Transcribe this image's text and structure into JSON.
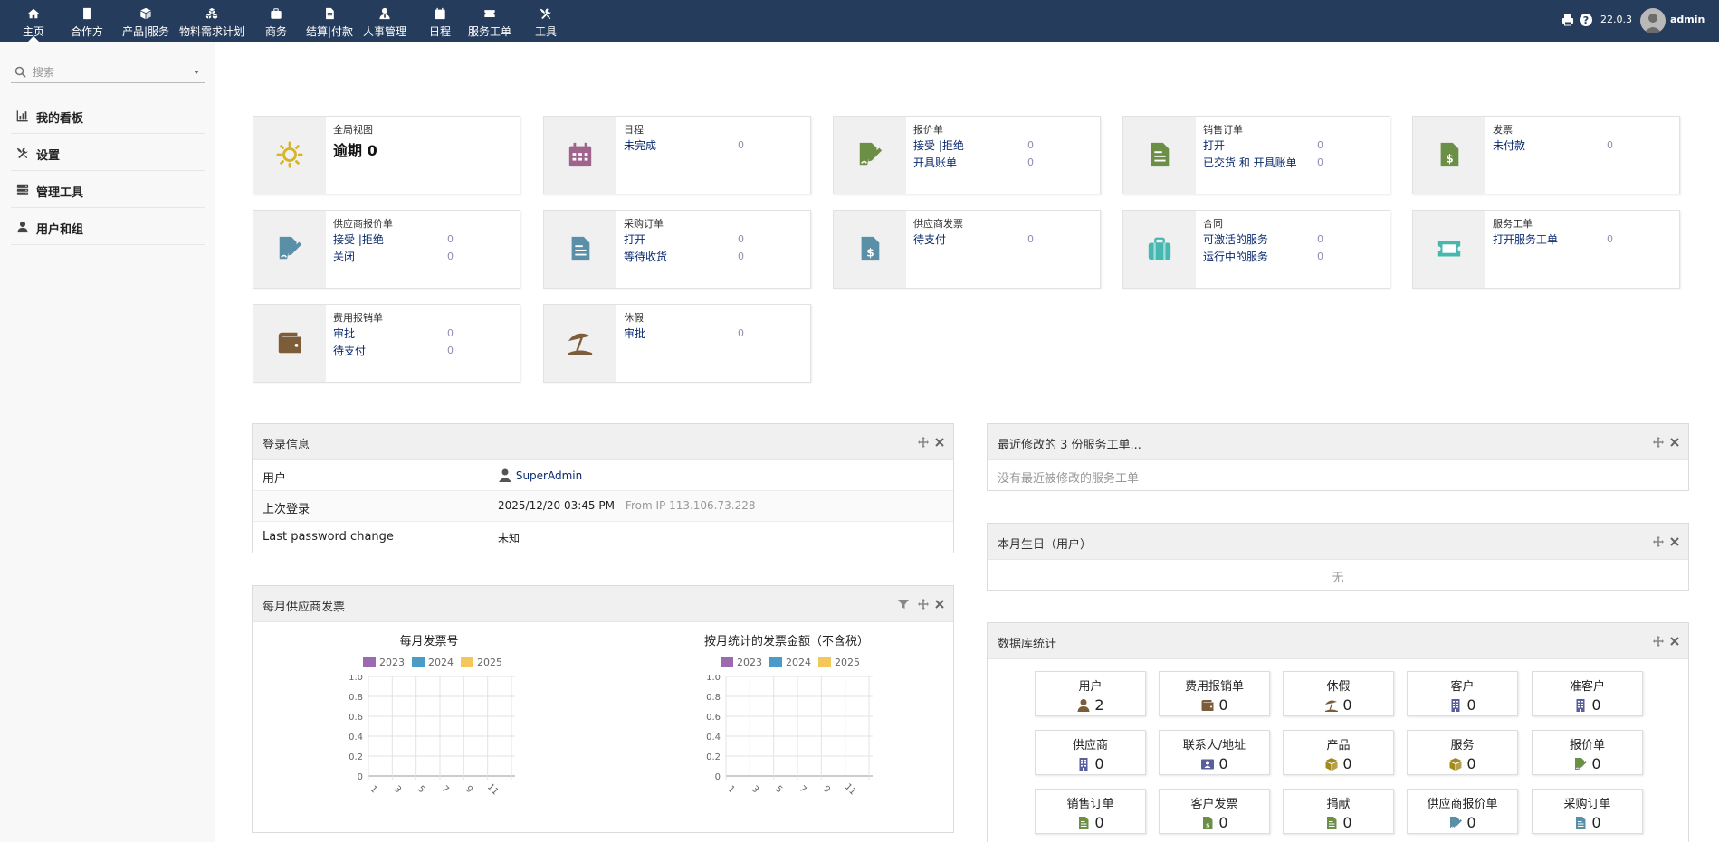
{
  "topbar": {
    "menu": [
      {
        "label": "主页",
        "icon": "home-icon",
        "active": true
      },
      {
        "label": "合作方",
        "icon": "building-icon"
      },
      {
        "label": "产品|服务",
        "icon": "cube-icon"
      },
      {
        "label": "物料需求计划",
        "icon": "cubes-icon"
      },
      {
        "label": "商务",
        "icon": "suitcase-icon"
      },
      {
        "label": "结算|付款",
        "icon": "file-invoice-icon"
      },
      {
        "label": "人事管理",
        "icon": "user-tie-icon"
      },
      {
        "label": "日程",
        "icon": "calendar-icon"
      },
      {
        "label": "服务工单",
        "icon": "ticket-icon"
      },
      {
        "label": "工具",
        "icon": "tools-icon"
      }
    ],
    "version": "22.0.3",
    "user": "admin"
  },
  "sidebar": {
    "search_placeholder": "搜索",
    "items": [
      {
        "label": "我的看板",
        "icon": "chart-icon"
      },
      {
        "label": "设置",
        "icon": "tools-icon"
      },
      {
        "label": "管理工具",
        "icon": "server-icon"
      },
      {
        "label": "用户和组",
        "icon": "user-icon"
      }
    ]
  },
  "boxes": [
    {
      "title": "全局视图",
      "big": "逾期 0",
      "icon": "sun-icon",
      "icon_color": "#d6b52a"
    },
    {
      "title": "日程",
      "icon": "calendar-icon",
      "icon_color": "#a0648c",
      "rows": [
        {
          "label": "未完成",
          "count": "0"
        }
      ]
    },
    {
      "title": "报价单",
      "icon": "file-signature-icon",
      "icon_color": "#6b8f47",
      "rows": [
        {
          "label": "接受 |拒绝",
          "count": "0"
        },
        {
          "label": "开具账单",
          "count": "0"
        }
      ]
    },
    {
      "title": "销售订单",
      "icon": "file-text-icon",
      "icon_color": "#6b8f47",
      "rows": [
        {
          "label": "打开",
          "count": "0"
        },
        {
          "label": "已交货 和 开具账单",
          "count": "0"
        }
      ]
    },
    {
      "title": "发票",
      "icon": "file-dollar-icon",
      "icon_color": "#6b8f47",
      "rows": [
        {
          "label": "未付款",
          "count": "0"
        }
      ]
    },
    {
      "title": "供应商报价单",
      "icon": "file-signature-icon",
      "icon_color": "#5a8fa8",
      "rows": [
        {
          "label": "接受 |拒绝",
          "count": "0"
        },
        {
          "label": "关闭",
          "count": "0"
        }
      ]
    },
    {
      "title": "采购订单",
      "icon": "file-text-icon",
      "icon_color": "#5a8fa8",
      "rows": [
        {
          "label": "打开",
          "count": "0"
        },
        {
          "label": "等待收货",
          "count": "0"
        }
      ]
    },
    {
      "title": "供应商发票",
      "icon": "file-dollar-icon",
      "icon_color": "#5a8fa8",
      "rows": [
        {
          "label": "待支付",
          "count": "0"
        }
      ]
    },
    {
      "title": "合同",
      "icon": "suitcase-icon",
      "icon_color": "#46b8b0",
      "rows": [
        {
          "label": "可激活的服务",
          "count": "0"
        },
        {
          "label": "运行中的服务",
          "count": "0"
        }
      ]
    },
    {
      "title": "服务工单",
      "icon": "ticket-icon",
      "icon_color": "#46b8b0",
      "rows": [
        {
          "label": "打开服务工单",
          "count": "0"
        }
      ]
    },
    {
      "title": "费用报销单",
      "icon": "wallet-icon",
      "icon_color": "#7d5c3a",
      "rows": [
        {
          "label": "审批",
          "count": "0"
        },
        {
          "label": "待支付",
          "count": "0"
        }
      ]
    },
    {
      "title": "休假",
      "icon": "umbrella-beach-icon",
      "icon_color": "#7d5c3a",
      "rows": [
        {
          "label": "审批",
          "count": "0"
        }
      ]
    }
  ],
  "login_panel": {
    "title": "登录信息",
    "rows": [
      {
        "key": "用户",
        "value": "SuperAdmin"
      },
      {
        "key": "上次登录",
        "value": "2025/12/20 03:45 PM",
        "extra": " - From IP 113.106.73.228"
      },
      {
        "key": "Last password change",
        "value": "未知"
      }
    ]
  },
  "tickets_panel": {
    "title": "最近修改的 3 份服务工单...",
    "empty": "没有最近被修改的服务工单"
  },
  "birthday_panel": {
    "title": "本月生日（用户）",
    "empty": "无"
  },
  "invoice_panel": {
    "title": "每月供应商发票"
  },
  "chart_data": [
    {
      "type": "bar",
      "title": "每月发票号",
      "series": [
        {
          "name": "2023",
          "values": [],
          "color": "#9c6ab0"
        },
        {
          "name": "2024",
          "values": [],
          "color": "#4a9bc7"
        },
        {
          "name": "2025",
          "values": [],
          "color": "#f3c75a"
        }
      ],
      "x_ticks": [
        "1",
        "3",
        "5",
        "7",
        "9",
        "11"
      ],
      "y_ticks": [
        "0",
        "0.2",
        "0.4",
        "0.6",
        "0.8",
        "1.0"
      ],
      "ylim": [
        0,
        1
      ],
      "grid": true,
      "legend": "top"
    },
    {
      "type": "bar",
      "title": "按月统计的发票金额（不含税）",
      "series": [
        {
          "name": "2023",
          "values": [],
          "color": "#9c6ab0"
        },
        {
          "name": "2024",
          "values": [],
          "color": "#4a9bc7"
        },
        {
          "name": "2025",
          "values": [],
          "color": "#f3c75a"
        }
      ],
      "x_ticks": [
        "1",
        "3",
        "5",
        "7",
        "9",
        "11"
      ],
      "y_ticks": [
        "0",
        "0.2",
        "0.4",
        "0.6",
        "0.8",
        "1.0"
      ],
      "ylim": [
        0,
        1
      ],
      "grid": true,
      "legend": "top"
    }
  ],
  "stats_panel": {
    "title": "数据库统计",
    "tiles": [
      {
        "label": "用户",
        "value": "2",
        "icon": "user-icon",
        "color": "#7d5c3a"
      },
      {
        "label": "费用报销单",
        "value": "0",
        "icon": "wallet-icon",
        "color": "#7d5c3a"
      },
      {
        "label": "休假",
        "value": "0",
        "icon": "umbrella-beach-icon",
        "color": "#7d5c3a"
      },
      {
        "label": "客户",
        "value": "0",
        "icon": "building-icon",
        "color": "#5b5e9e"
      },
      {
        "label": "准客户",
        "value": "0",
        "icon": "building-icon",
        "color": "#5b5e9e"
      },
      {
        "label": "供应商",
        "value": "0",
        "icon": "building-icon",
        "color": "#5b5e9e"
      },
      {
        "label": "联系人/地址",
        "value": "0",
        "icon": "address-card-icon",
        "color": "#5b5e9e"
      },
      {
        "label": "产品",
        "value": "0",
        "icon": "cube-icon",
        "color": "#a38a1f"
      },
      {
        "label": "服务",
        "value": "0",
        "icon": "cube-icon",
        "color": "#a38a1f"
      },
      {
        "label": "报价单",
        "value": "0",
        "icon": "file-signature-icon",
        "color": "#6b8f47"
      },
      {
        "label": "销售订单",
        "value": "0",
        "icon": "file-text-icon",
        "color": "#6b8f47"
      },
      {
        "label": "客户发票",
        "value": "0",
        "icon": "file-dollar-icon",
        "color": "#6b8f47"
      },
      {
        "label": "捐献",
        "value": "0",
        "icon": "file-text-icon",
        "color": "#6b8f47"
      },
      {
        "label": "供应商报价单",
        "value": "0",
        "icon": "file-signature-icon",
        "color": "#5a8fa8"
      },
      {
        "label": "采购订单",
        "value": "0",
        "icon": "file-text-icon",
        "color": "#5a8fa8"
      }
    ]
  }
}
